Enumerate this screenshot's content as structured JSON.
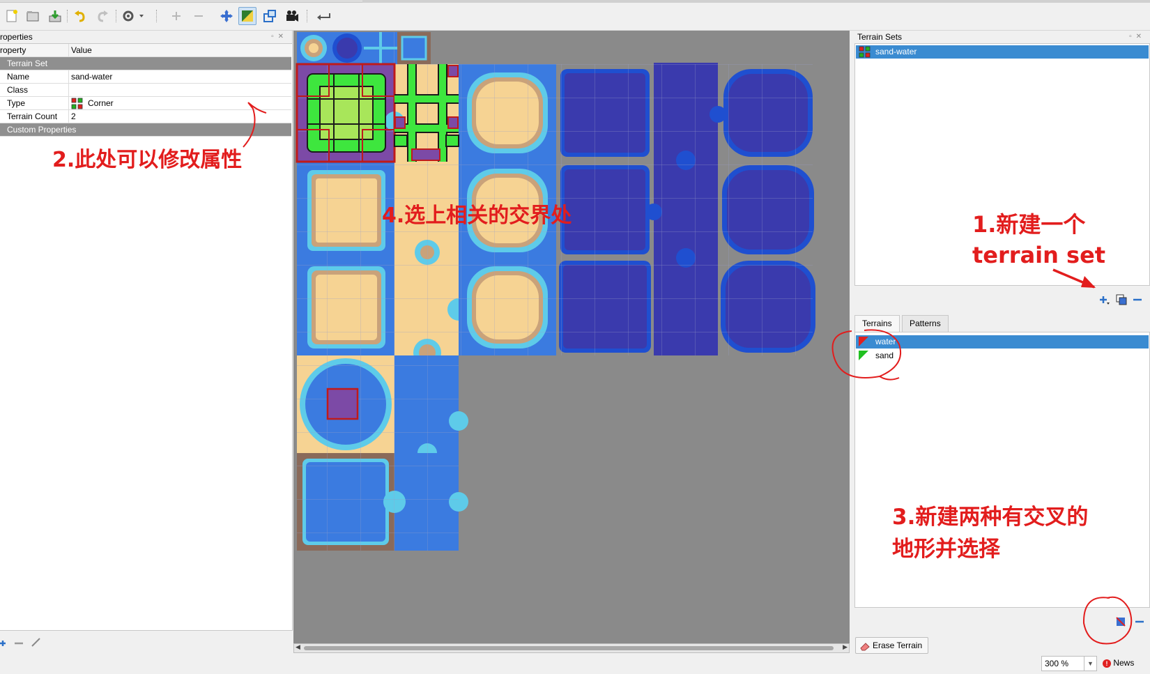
{
  "toolbar": {
    "icons": [
      "new-tileset-icon",
      "open-icon",
      "save-icon",
      "undo-icon",
      "redo-icon",
      "settings-icon",
      "add-tile-icon",
      "remove-tile-icon",
      "dynamic-wrapping-icon",
      "terrain-edit-icon",
      "collision-icon",
      "animation-icon",
      "back-icon"
    ]
  },
  "properties": {
    "title": "roperties",
    "header_property": "roperty",
    "header_value": "Value",
    "group_terrain_set": "Terrain Set",
    "rows": [
      {
        "key": "Name",
        "value": "sand-water"
      },
      {
        "key": "Class",
        "value": ""
      },
      {
        "key": "Type",
        "value": "Corner"
      },
      {
        "key": "Terrain Count",
        "value": "2"
      }
    ],
    "group_custom": "Custom Properties"
  },
  "terrain_sets": {
    "title": "Terrain Sets",
    "items": [
      {
        "label": "sand-water",
        "selected": true
      }
    ]
  },
  "terrain_tabs": {
    "tabs": [
      "Terrains",
      "Patterns"
    ],
    "active": "Terrains",
    "items": [
      {
        "label": "water",
        "color": "#e02020",
        "selected": true
      },
      {
        "label": "sand",
        "color": "#20c020",
        "selected": false
      }
    ]
  },
  "footer": {
    "erase_label": "Erase Terrain",
    "zoom": "300 %",
    "news": "News"
  },
  "annotations": {
    "a1_line1": "1.新建一个",
    "a1_line2": "terrain set",
    "a2": "2.此处可以修改属性",
    "a3_line1": "3.新建两种有交叉的",
    "a3_line2": "地形并选择",
    "a4": "4.选上相关的交界处"
  },
  "colors": {
    "selection": "#3a8bd1",
    "annotation": "#e21d1d",
    "water": "#3b6fe0",
    "deep_water": "#3a3aad",
    "sand": "#f6d393",
    "terrain_highlight": "#3ee63e"
  }
}
